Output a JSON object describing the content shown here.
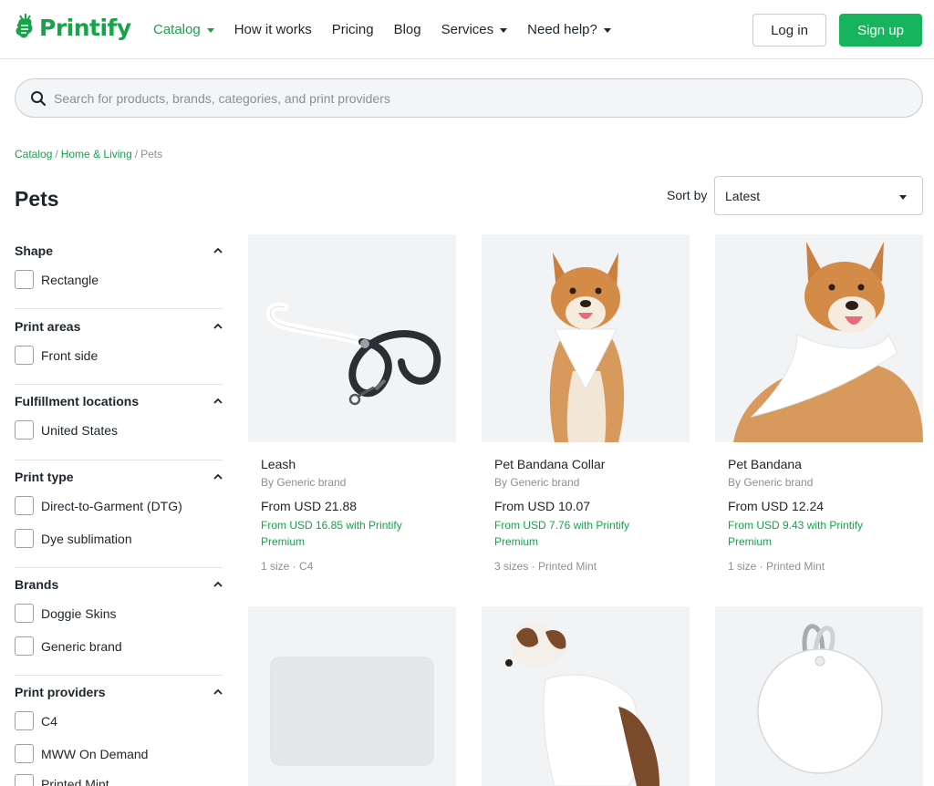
{
  "header": {
    "logo_text": "Printify",
    "nav": [
      {
        "label": "Catalog",
        "dropdown": true,
        "active": true
      },
      {
        "label": "How it works",
        "dropdown": false
      },
      {
        "label": "Pricing",
        "dropdown": false
      },
      {
        "label": "Blog",
        "dropdown": false
      },
      {
        "label": "Services",
        "dropdown": true
      },
      {
        "label": "Need help?",
        "dropdown": true
      }
    ],
    "login_label": "Log in",
    "signup_label": "Sign up"
  },
  "search": {
    "placeholder": "Search for products, brands, categories, and print providers"
  },
  "breadcrumb": {
    "items": [
      "Catalog",
      "Home & Living"
    ],
    "current": "Pets"
  },
  "page_title": "Pets",
  "sort": {
    "label": "Sort by",
    "selected": "Latest"
  },
  "filters": [
    {
      "title": "Shape",
      "options": [
        "Rectangle"
      ]
    },
    {
      "title": "Print areas",
      "options": [
        "Front side"
      ]
    },
    {
      "title": "Fulfillment locations",
      "options": [
        "United States"
      ]
    },
    {
      "title": "Print type",
      "options": [
        "Direct-to-Garment (DTG)",
        "Dye sublimation"
      ]
    },
    {
      "title": "Brands",
      "options": [
        "Doggie Skins",
        "Generic brand"
      ]
    },
    {
      "title": "Print providers",
      "options": [
        "C4",
        "MWW On Demand",
        "Printed Mint"
      ]
    }
  ],
  "products": [
    {
      "name": "Leash",
      "brand": "By Generic brand",
      "price": "From USD 21.88",
      "premium": "From USD 16.85 with Printify Premium",
      "meta": "1 size · C4",
      "image": "leash-icon"
    },
    {
      "name": "Pet Bandana Collar",
      "brand": "By Generic brand",
      "price": "From USD 10.07",
      "premium": "From USD 7.76 with Printify Premium",
      "meta": "3 sizes · Printed Mint",
      "image": "dog-bandana-collar-icon"
    },
    {
      "name": "Pet Bandana",
      "brand": "By Generic brand",
      "price": "From USD 12.24",
      "premium": "From USD 9.43 with Printify Premium",
      "meta": "1 size · Printed Mint",
      "image": "dog-bandana-icon"
    },
    {
      "image": "pet-mat-icon"
    },
    {
      "image": "dog-shirt-icon"
    },
    {
      "image": "pet-tag-icon"
    }
  ],
  "colors": {
    "brand_green": "#17a34a",
    "signup_green": "#17b45e",
    "text": "#1d252c",
    "muted": "#8a9097"
  }
}
